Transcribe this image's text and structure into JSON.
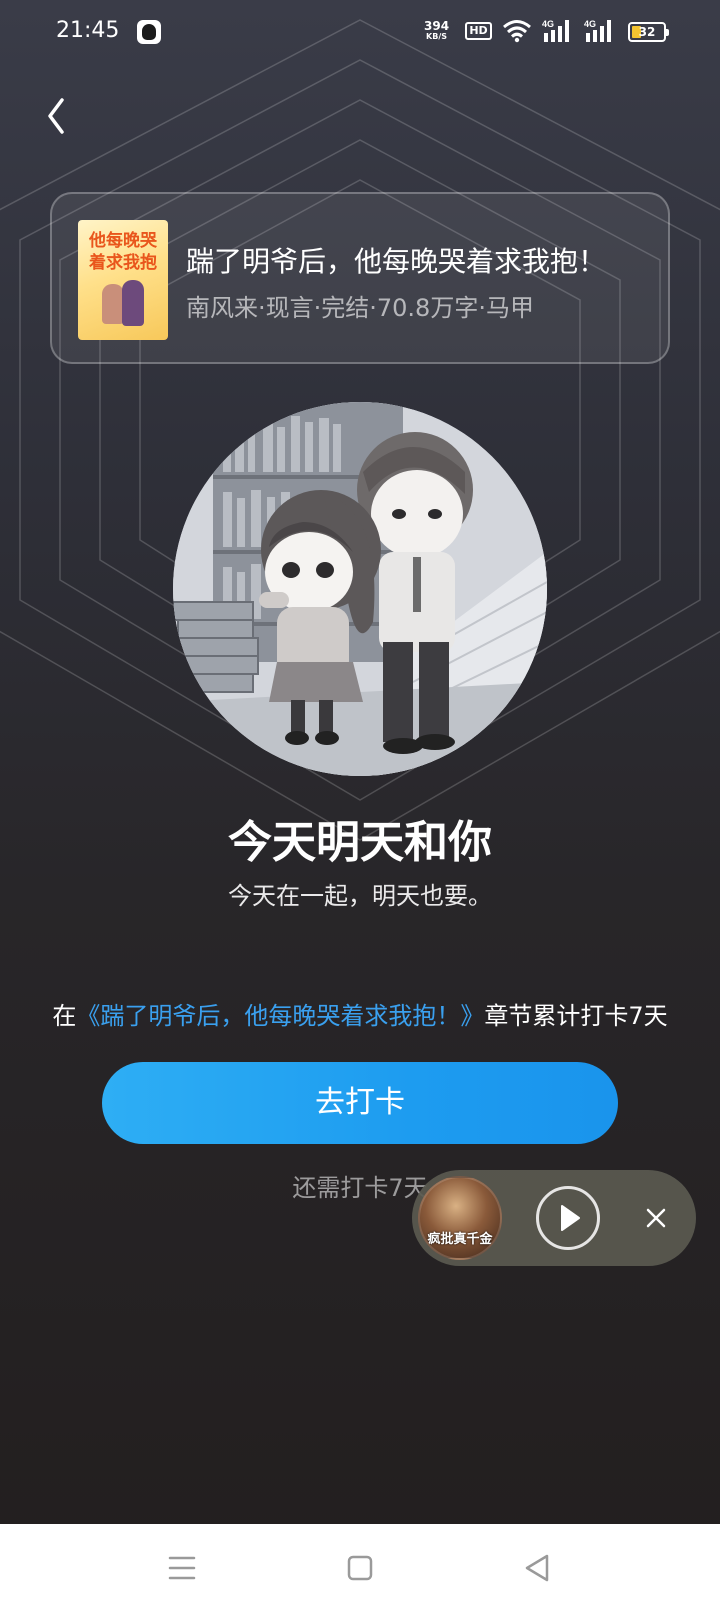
{
  "status_bar": {
    "time": "21:45",
    "net_speed_value": "394",
    "net_speed_unit": "KB/S",
    "hd_label": "HD",
    "signal_label_1": "4G",
    "signal_label_2": "4G",
    "battery_level": "32",
    "icons": [
      "qq-app-icon",
      "hd-icon",
      "wifi-icon",
      "signal-icon",
      "signal-icon",
      "battery-icon"
    ]
  },
  "header": {
    "back_icon": "chevron-left-icon"
  },
  "book": {
    "cover_text": "他每晚哭着求我抱",
    "title": "踹了明爷后，他每晚哭着求我抱！",
    "meta": "南风来·现言·完结·70.8万字·马甲"
  },
  "badge": {
    "title": "今天明天和你",
    "subtitle": "今天在一起，明天也要。"
  },
  "progress": {
    "prefix": "在",
    "book_link": "《踹了明爷后，他每晚哭着求我抱！》",
    "suffix": "章节累计打卡7天"
  },
  "checkin": {
    "button_label": "去打卡",
    "remaining_text": "还需打卡7天"
  },
  "audio_player": {
    "cover_text": "疯批真千金",
    "play_icon": "play-icon",
    "close_icon": "close-icon"
  },
  "nav_bar": {
    "icons": [
      "menu-icon",
      "home-icon",
      "back-icon"
    ]
  },
  "colors": {
    "accent": "#1d9cf0",
    "link": "#3aa0ef",
    "battery": "#f4c430"
  }
}
